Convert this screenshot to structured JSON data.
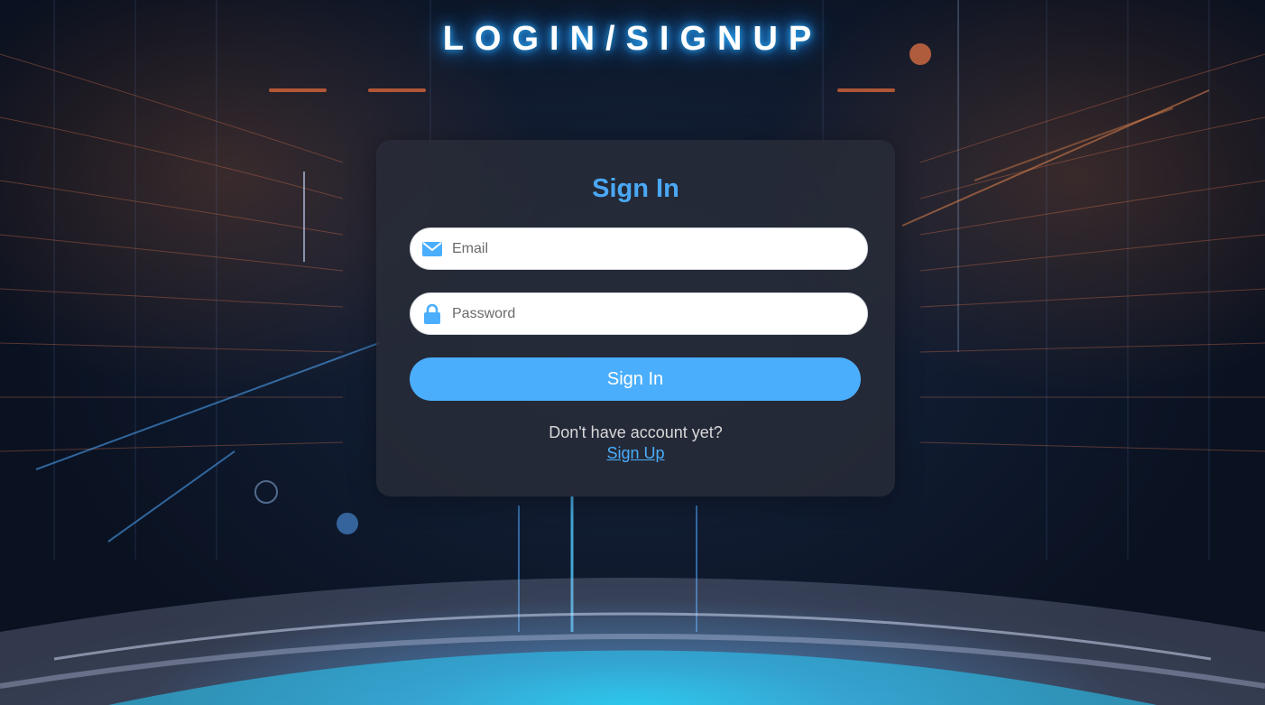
{
  "page": {
    "title": "LOGIN/SIGNUP"
  },
  "form": {
    "heading": "Sign In",
    "email": {
      "placeholder": "Email",
      "value": "",
      "icon": "envelope-icon"
    },
    "password": {
      "placeholder": "Password",
      "value": "",
      "icon": "lock-icon"
    },
    "submit_label": "Sign In",
    "prompt_text": "Don't have account yet?",
    "signup_link": "Sign Up"
  },
  "colors": {
    "accent": "#4aaefc",
    "heading": "#4aa8f5",
    "card": "#282c38",
    "title_glow": "#1e8fff"
  }
}
